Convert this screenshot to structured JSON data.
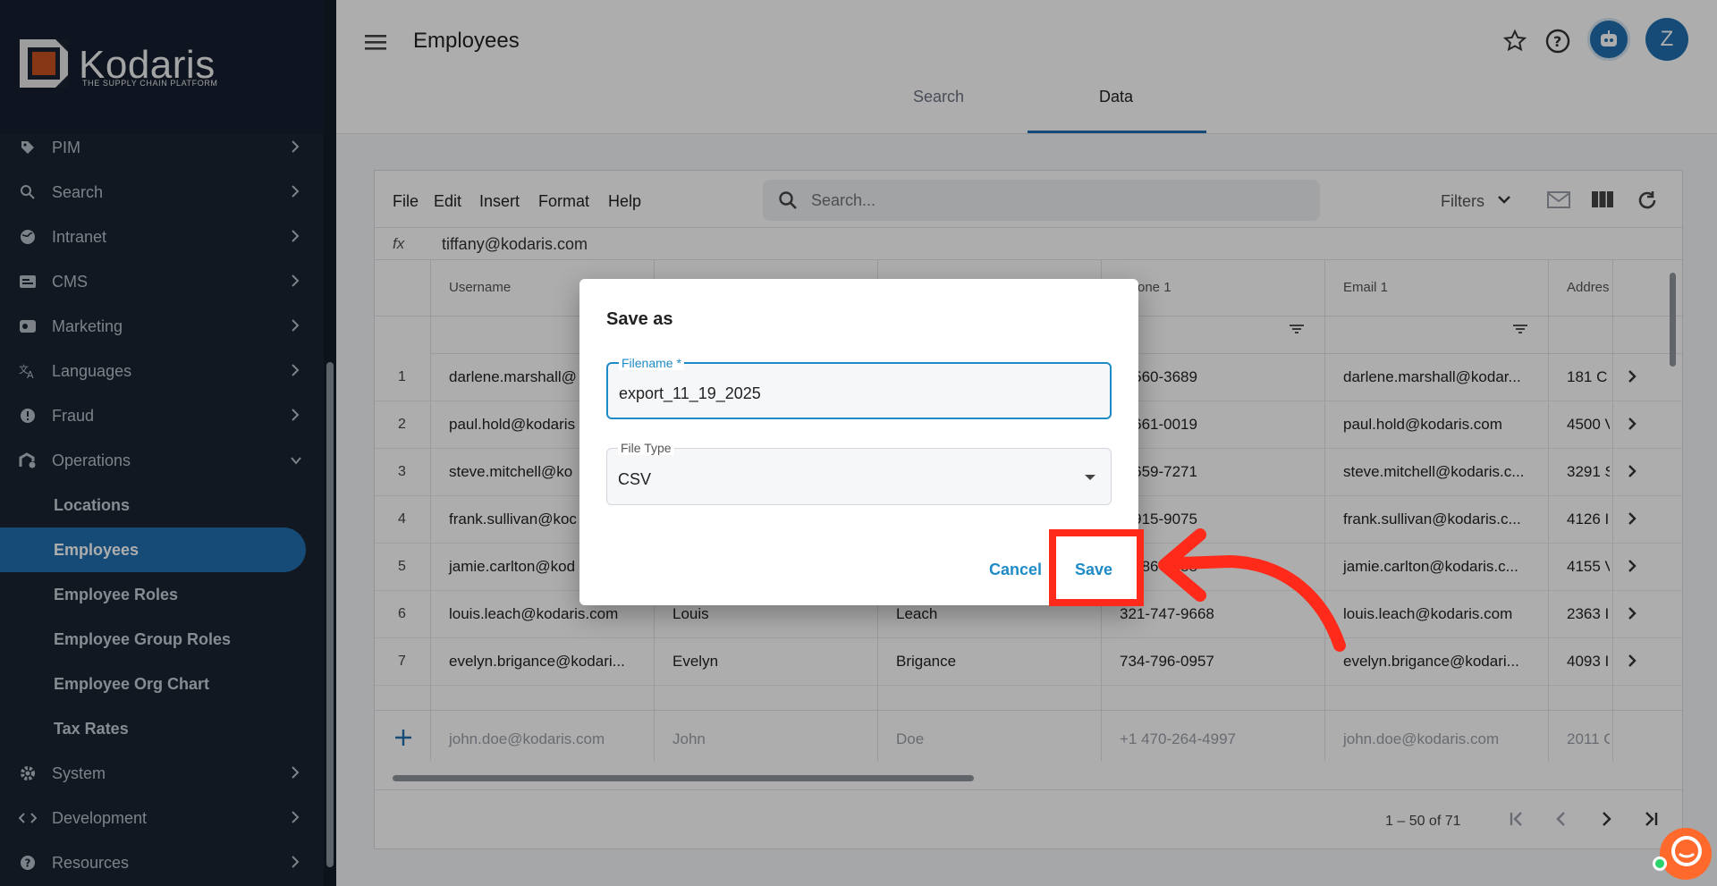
{
  "logo": {
    "name": "Kodaris",
    "tagline": "THE SUPPLY CHAIN PLATFORM"
  },
  "sidebar": {
    "items": [
      {
        "label": "PIM",
        "icon": "tag-icon"
      },
      {
        "label": "Search",
        "icon": "search-icon"
      },
      {
        "label": "Intranet",
        "icon": "globe-icon"
      },
      {
        "label": "CMS",
        "icon": "cms-icon"
      },
      {
        "label": "Marketing",
        "icon": "marketing-icon"
      },
      {
        "label": "Languages",
        "icon": "translate-icon"
      },
      {
        "label": "Fraud",
        "icon": "alert-icon"
      },
      {
        "label": "Operations",
        "icon": "operations-icon"
      }
    ],
    "operations_children": [
      "Locations",
      "Employees",
      "Employee Roles",
      "Employee Group Roles",
      "Employee Org Chart",
      "Tax Rates"
    ],
    "bottom_items": [
      {
        "label": "System",
        "icon": "gear-icon"
      },
      {
        "label": "Development",
        "icon": "code-icon"
      },
      {
        "label": "Resources",
        "icon": "help-icon"
      }
    ]
  },
  "header": {
    "title": "Employees",
    "avatar_initial": "Z"
  },
  "tabs": [
    "Search",
    "Data"
  ],
  "sheet": {
    "menu": [
      "File",
      "Edit",
      "Insert",
      "Format",
      "Help"
    ],
    "search_placeholder": "Search...",
    "filters_label": "Filters",
    "fx_label": "fx",
    "fx_value": "tiffany@kodaris.com",
    "columns": [
      "Username",
      "",
      "",
      "one 1",
      "Email 1",
      "Addres"
    ],
    "rows": [
      {
        "num": "1",
        "username": "darlene.marshall@",
        "first": "",
        "last": "",
        "phone": "0-560-3689",
        "email": "darlene.marshall@kodar...",
        "address": "181 C"
      },
      {
        "num": "2",
        "username": "paul.hold@kodaris",
        "first": "",
        "last": "",
        "phone": "5-661-0019",
        "email": "paul.hold@kodaris.com",
        "address": "4500 V"
      },
      {
        "num": "3",
        "username": "steve.mitchell@ko",
        "first": "",
        "last": "",
        "phone": "0-659-7271",
        "email": "steve.mitchell@kodaris.c...",
        "address": "3291 S"
      },
      {
        "num": "4",
        "username": "frank.sullivan@koc",
        "first": "",
        "last": "",
        "phone": "3-915-9075",
        "email": "frank.sullivan@kodaris.c...",
        "address": "4126 I"
      },
      {
        "num": "5",
        "username": "jamie.carlton@kod",
        "first": "",
        "last": "",
        "phone": "3-286-2888",
        "email": "jamie.carlton@kodaris.c...",
        "address": "4155 V"
      },
      {
        "num": "6",
        "username": "louis.leach@kodaris.com",
        "first": "Louis",
        "last": "Leach",
        "phone": "321-747-9668",
        "email": "louis.leach@kodaris.com",
        "address": "2363 I"
      },
      {
        "num": "7",
        "username": "evelyn.brigance@kodari...",
        "first": "Evelyn",
        "last": "Brigance",
        "phone": "734-796-0957",
        "email": "evelyn.brigance@kodari...",
        "address": "4093 I"
      }
    ],
    "new_row": {
      "username": "john.doe@kodaris.com",
      "first": "John",
      "last": "Doe",
      "phone": "+1 470-264-4997",
      "email": "john.doe@kodaris.com",
      "address": "2011 C"
    },
    "page_range": "1 – 50 of 71"
  },
  "dialog": {
    "title": "Save as",
    "filename_label": "Filename *",
    "filename_value": "export_11_19_2025",
    "filetype_label": "File Type",
    "filetype_value": "CSV",
    "cancel_label": "Cancel",
    "save_label": "Save"
  },
  "colors": {
    "accent": "#1f6fae",
    "dialog_accent": "#1f8bc6",
    "highlight": "#ff2a1a",
    "sidebar_bg": "#1b2433"
  }
}
